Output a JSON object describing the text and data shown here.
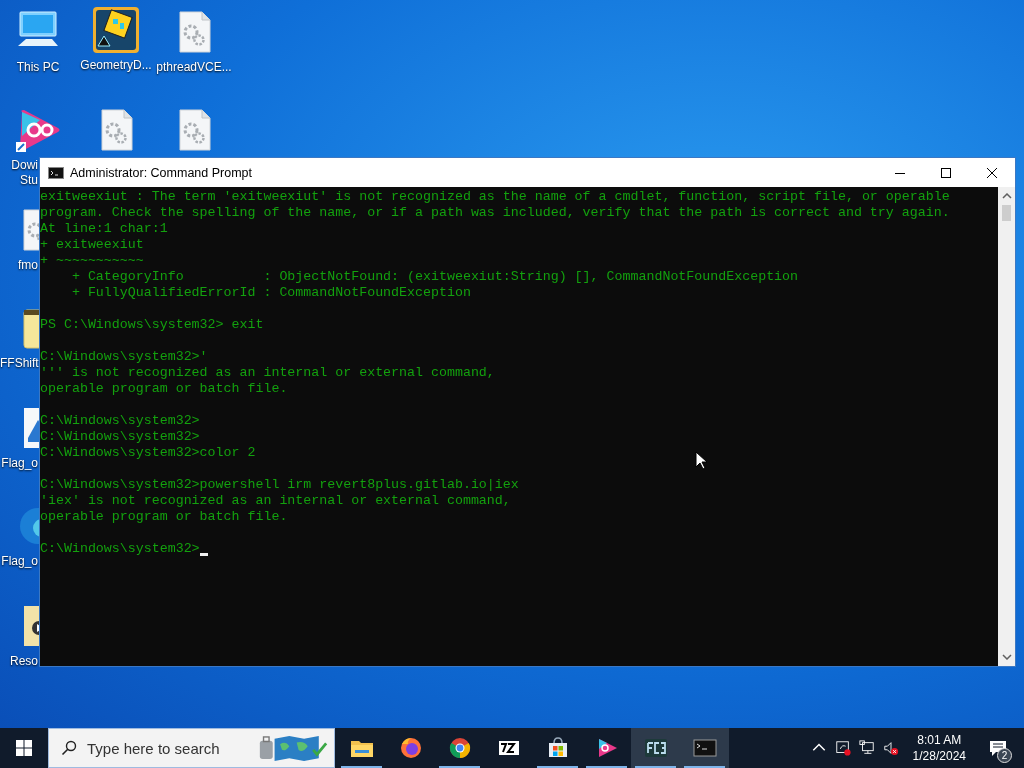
{
  "desktop": {
    "icons": [
      {
        "kind": "computer",
        "label": "This PC"
      },
      {
        "kind": "game",
        "label": "GeometryD..."
      },
      {
        "kind": "file",
        "label": "pthreadVCE..."
      },
      {
        "kind": "ds",
        "label": "Dowi Stu"
      },
      {
        "kind": "file"
      },
      {
        "kind": "file"
      },
      {
        "kind": "file",
        "label": "fmo"
      },
      {
        "kind": "archive",
        "label": "FFShift"
      },
      {
        "kind": "image",
        "label": "Flag_o"
      },
      {
        "kind": "edge",
        "label": "Flag_o"
      },
      {
        "kind": "video",
        "label": "Reso"
      }
    ]
  },
  "window": {
    "title": "Administrator: Command Prompt",
    "cursor_visible": true,
    "blocks": [
      [
        "exitweexiut : The term 'exitweexiut' is not recognized as the name of a cmdlet, function, script file, or operable",
        "program. Check the spelling of the name, or if a path was included, verify that the path is correct and try again.",
        "At line:1 char:1",
        "+ exitweexiut",
        "+ ~~~~~~~~~~~",
        "    + CategoryInfo          : ObjectNotFound: (exitweexiut:String) [], CommandNotFoundException",
        "    + FullyQualifiedErrorId : CommandNotFoundException"
      ],
      [
        "PS C:\\Windows\\system32> exit"
      ],
      [
        "C:\\Windows\\system32>'",
        "''' is not recognized as an internal or external command,",
        "operable program or batch file."
      ],
      [
        "C:\\Windows\\system32>",
        "C:\\Windows\\system32>",
        "C:\\Windows\\system32>color 2"
      ],
      [
        "C:\\Windows\\system32>powershell irm revert8plus.gitlab.io|iex",
        "'iex' is not recognized as an internal or external command,",
        "operable program or batch file."
      ],
      [
        "C:\\Windows\\system32>"
      ]
    ]
  },
  "taskbar": {
    "search": {
      "placeholder": "Type here to search"
    },
    "apps": [
      {
        "kind": "explorer",
        "running": true,
        "selected": false
      },
      {
        "kind": "firefox",
        "running": false,
        "selected": false
      },
      {
        "kind": "chrome",
        "running": true,
        "selected": false
      },
      {
        "kind": "sevenzip",
        "running": false,
        "selected": false
      },
      {
        "kind": "store",
        "running": true,
        "selected": false
      },
      {
        "kind": "ds",
        "running": true,
        "selected": false
      },
      {
        "kind": "fc3",
        "running": true,
        "selected": true
      },
      {
        "kind": "cmd",
        "running": true,
        "selected": true
      }
    ],
    "time": "8:01 AM",
    "date": "1/28/2024",
    "notifications": "2"
  }
}
